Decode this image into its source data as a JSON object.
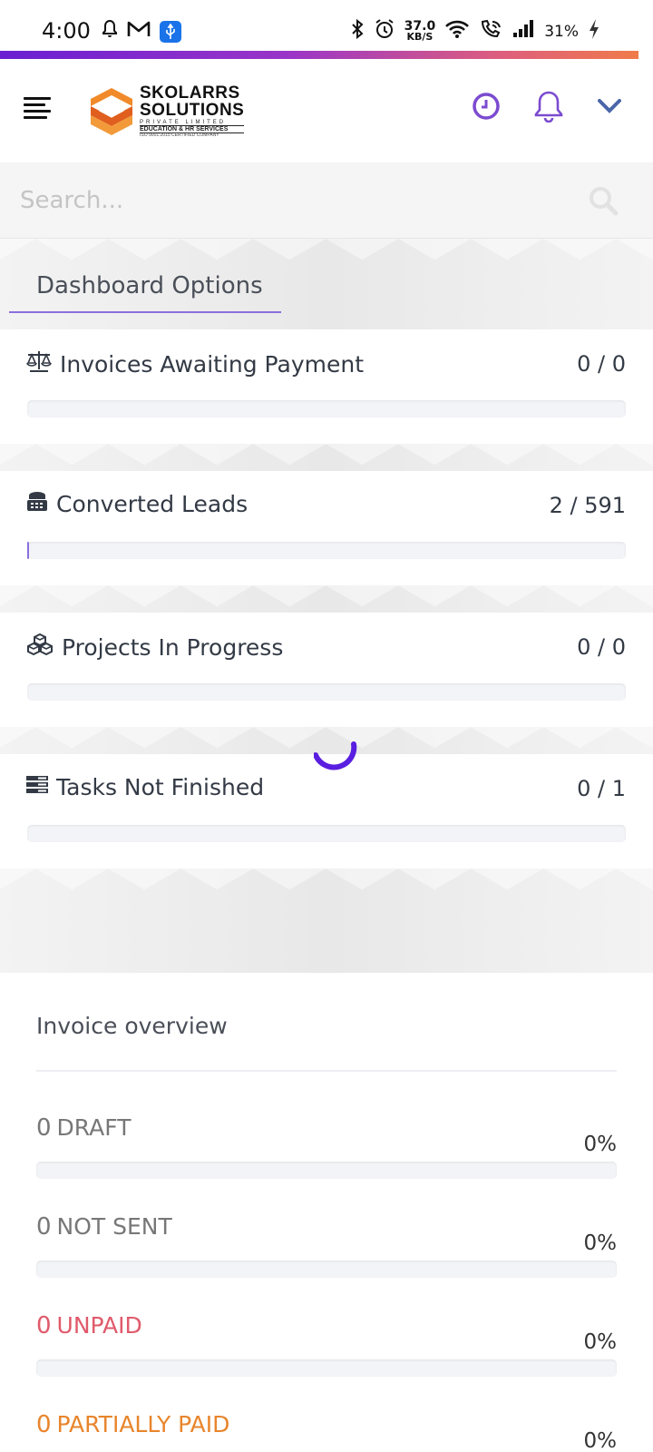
{
  "status_bar": {
    "time": "4:00",
    "net_speed_value": "37.0",
    "net_speed_unit": "KB/S",
    "battery": "31%",
    "icons": [
      "bell-icon",
      "gmail-icon",
      "usb-icon",
      "bluetooth-icon",
      "alarm-icon",
      "wifi-icon",
      "wifi-call-icon",
      "signal-icon",
      "charging-icon"
    ]
  },
  "accent_gradient": [
    "#6a1fd1",
    "#f07b4a"
  ],
  "header": {
    "logo": {
      "line1": "SKOLARRS",
      "line2": "SOLUTIONS",
      "line3": "PRIVATE LIMITED",
      "line4": "EDUCATION & HR SERVICES",
      "line5": "ISO 9001:2015 CERTIFIED COMPANY"
    },
    "icons": [
      "menu-icon",
      "clock-icon",
      "bell-icon",
      "chevron-down-icon"
    ],
    "icon_color": "#7b4bd0"
  },
  "search": {
    "placeholder": "Search..."
  },
  "dashboard": {
    "tab_label": "Dashboard Options",
    "cards": [
      {
        "icon": "balance-scale-icon",
        "title": "Invoices Awaiting Payment",
        "count": "0 / 0",
        "progress": 0
      },
      {
        "icon": "fax-icon",
        "title": "Converted Leads",
        "count": "2 / 591",
        "progress": 0.0034
      },
      {
        "icon": "cubes-icon",
        "title": "Projects In Progress",
        "count": "0 / 0",
        "progress": 0
      },
      {
        "icon": "tasks-icon",
        "title": "Tasks Not Finished",
        "count": "0 / 1",
        "progress": 0
      }
    ]
  },
  "invoice_overview": {
    "title": "Invoice overview",
    "rows": [
      {
        "count": "0",
        "label": "DRAFT",
        "percent": "0%",
        "color": "#777777"
      },
      {
        "count": "0",
        "label": "NOT SENT",
        "percent": "0%",
        "color": "#777777"
      },
      {
        "count": "0",
        "label": "UNPAID",
        "percent": "0%",
        "color": "#e05a6b"
      },
      {
        "count": "0",
        "label": "PARTIALLY PAID",
        "percent": "0%",
        "color": "#e8852c"
      }
    ]
  }
}
